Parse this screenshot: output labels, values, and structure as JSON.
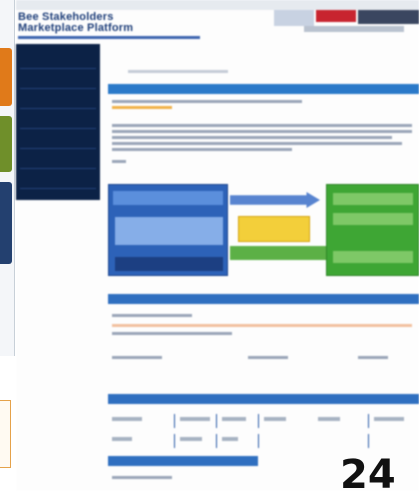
{
  "site": {
    "logo_line1": "Bee Stakeholders",
    "logo_line2": "Marketplace Platform"
  },
  "left_panel": {
    "tabs": [
      {
        "name": "tab-orange",
        "color": "#e07a1a"
      },
      {
        "name": "tab-olive",
        "color": "#6f8f2a"
      },
      {
        "name": "tab-navy",
        "color": "#23406f"
      }
    ]
  },
  "nav": {
    "items": [
      "",
      "",
      "",
      "",
      "",
      "",
      ""
    ]
  },
  "main": {
    "breadcrumb": "",
    "section1_title": "",
    "section2_title": "",
    "section3_title": "",
    "section4_title": ""
  },
  "diagram": {
    "left_title": "",
    "left_footer": "",
    "middle_label": "",
    "right_box_1": "",
    "right_box_2": "",
    "right_box_3": ""
  },
  "overlay_glyph": "24",
  "colors": {
    "nav_bg": "#0c2246",
    "section_blue": "#2a79c9",
    "diagram_blue": "#2d62b8",
    "diagram_green": "#3ea634",
    "diagram_yellow": "#f3cf3a"
  }
}
